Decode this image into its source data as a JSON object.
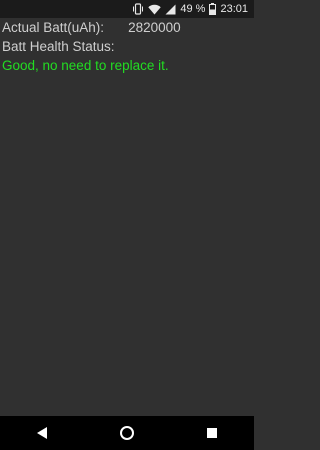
{
  "status_bar": {
    "battery_percent": "49 %",
    "time": "23:01",
    "icons": [
      "vibrate-icon",
      "wifi-icon",
      "signal-icon",
      "battery-icon"
    ]
  },
  "content": {
    "actual_batt_label": "Actual Batt(uAh):",
    "actual_batt_value": "2820000",
    "health_label": "Batt Health Status:",
    "health_value": "Good, no need to replace it."
  },
  "nav_bar": {
    "icons": [
      "back-icon",
      "home-icon",
      "recents-icon"
    ]
  },
  "colors": {
    "background": "#303030",
    "text": "#cfcfcf",
    "status_good": "#22dd22",
    "status_bar": "#1b1b1b",
    "nav_bar": "#000000"
  }
}
